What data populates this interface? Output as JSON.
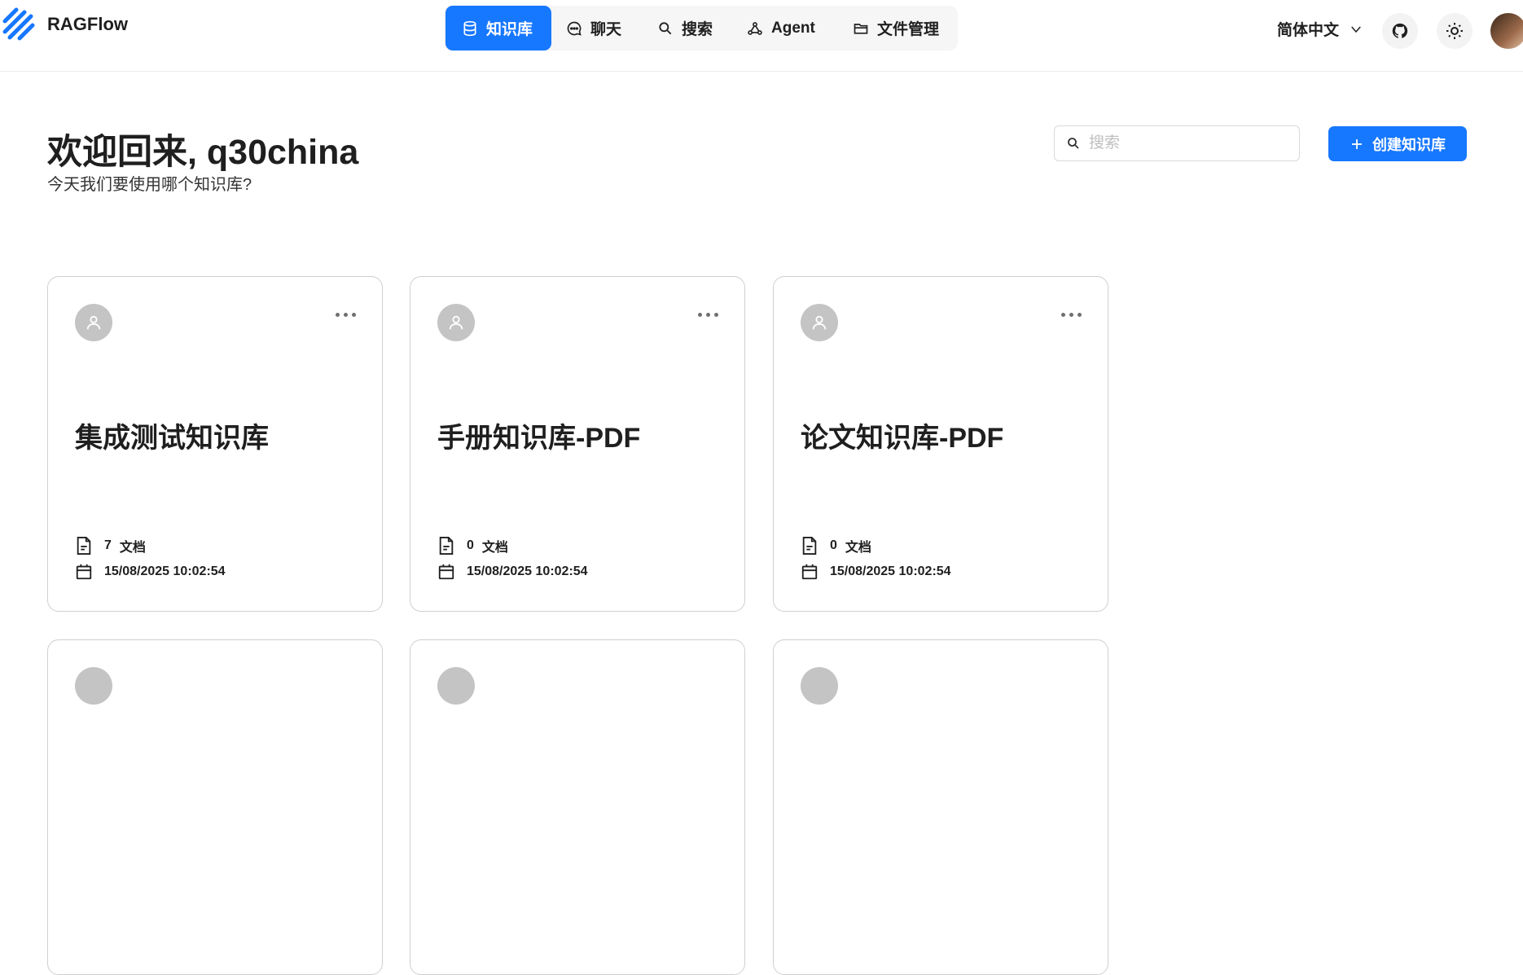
{
  "header": {
    "brand": "RAGFlow",
    "nav": [
      {
        "label": "知识库",
        "icon": "database-icon",
        "active": true
      },
      {
        "label": "聊天",
        "icon": "chat-icon",
        "active": false
      },
      {
        "label": "搜索",
        "icon": "search-icon",
        "active": false
      },
      {
        "label": "Agent",
        "icon": "agent-icon",
        "active": false
      },
      {
        "label": "文件管理",
        "icon": "folder-icon",
        "active": false
      }
    ],
    "language": "简体中文"
  },
  "main": {
    "welcome": "欢迎回来, q30china",
    "subtitle": "今天我们要使用哪个知识库?",
    "search_placeholder": "搜索",
    "create_label": "创建知识库"
  },
  "knowledge_bases": [
    {
      "name": "集成测试知识库",
      "doc_count": "7",
      "doc_unit": "文档",
      "date": "15/08/2025 10:02:54"
    },
    {
      "name": "手册知识库-PDF",
      "doc_count": "0",
      "doc_unit": "文档",
      "date": "15/08/2025 10:02:54"
    },
    {
      "name": "论文知识库-PDF",
      "doc_count": "0",
      "doc_unit": "文档",
      "date": "15/08/2025 10:02:54"
    }
  ],
  "colors": {
    "accent": "#1677ff",
    "avatar_placeholder": "#c4c4c4",
    "nav_background": "#f6f6f6"
  }
}
